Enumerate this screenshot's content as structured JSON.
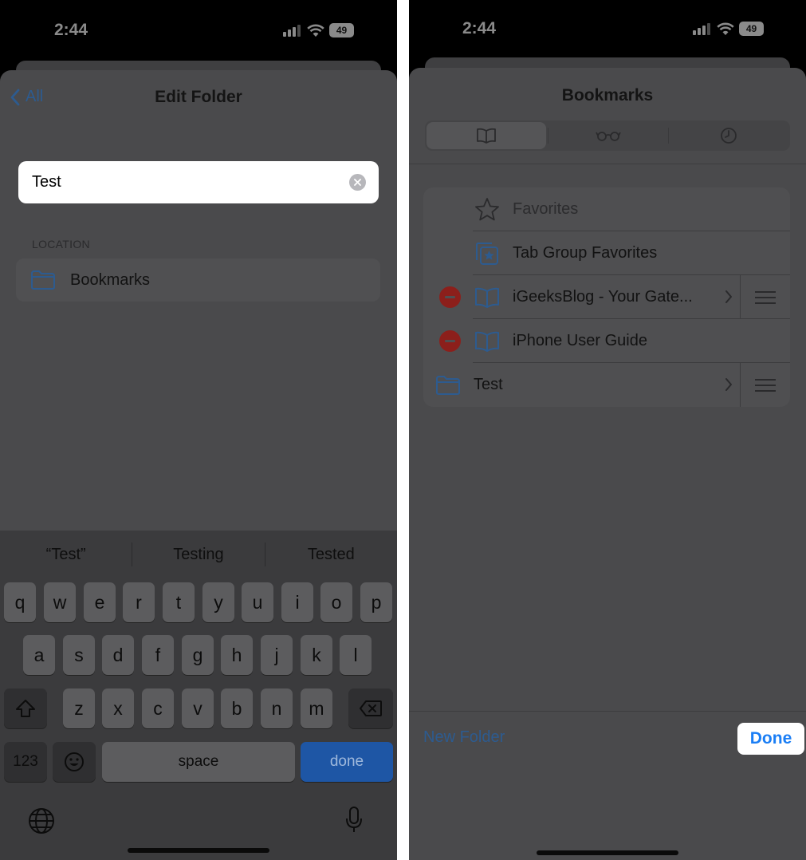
{
  "left_screen": {
    "status_bar": {
      "time": "2:44",
      "battery": "49"
    },
    "nav": {
      "back_label": "All",
      "title": "Edit Folder"
    },
    "folder_name_field": {
      "value": "Test"
    },
    "location": {
      "section_label": "LOCATION",
      "folder_label": "Bookmarks"
    },
    "keyboard": {
      "suggestions": [
        "“Test”",
        "Testing",
        "Tested"
      ],
      "row1": [
        "q",
        "w",
        "e",
        "r",
        "t",
        "y",
        "u",
        "i",
        "o",
        "p"
      ],
      "row2": [
        "a",
        "s",
        "d",
        "f",
        "g",
        "h",
        "j",
        "k",
        "l"
      ],
      "row3": [
        "z",
        "x",
        "c",
        "v",
        "b",
        "n",
        "m"
      ],
      "numbers_key": "123",
      "space_key": "space",
      "done_key": "done"
    }
  },
  "right_screen": {
    "status_bar": {
      "time": "2:44",
      "battery": "49"
    },
    "title": "Bookmarks",
    "tabs": [
      {
        "icon": "book-icon",
        "active": true
      },
      {
        "icon": "reading-glasses-icon",
        "active": false
      },
      {
        "icon": "history-clock-icon",
        "active": false
      }
    ],
    "bookmarks": [
      {
        "label": "Favorites",
        "icon": "star-icon"
      },
      {
        "label": "Tab Group Favorites",
        "icon": "tab-group-star-icon"
      },
      {
        "label": "iGeeksBlog - Your Gate...",
        "icon": "book-icon"
      },
      {
        "label": "iPhone User Guide",
        "icon": "book-icon"
      },
      {
        "label": "Test",
        "icon": "folder-icon"
      }
    ],
    "footer": {
      "new_folder_label": "New Folder",
      "done_label": "Done"
    },
    "colors": {
      "accent_blue": "#1a7ef5",
      "delete_red": "#8c1f1b"
    }
  }
}
